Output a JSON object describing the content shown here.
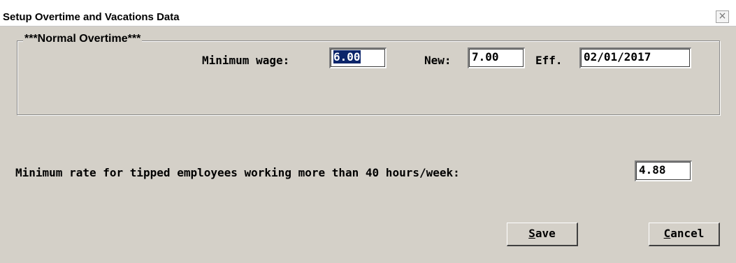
{
  "window": {
    "title": "Setup Overtime and Vacations Data",
    "close_glyph": "×"
  },
  "normal_overtime": {
    "legend": "***Normal Overtime***",
    "minimum_wage_label": "Minimum wage:",
    "minimum_wage_value": "6.00",
    "new_label": "New:",
    "new_value": "7.00",
    "eff_label": "Eff.",
    "eff_value": "02/01/2017"
  },
  "tipped": {
    "label": "Minimum rate for tipped employees working more than 40 hours/week:",
    "value": "4.88"
  },
  "buttons": {
    "save_accel": "S",
    "save_rest": "ave",
    "cancel_accel": "C",
    "cancel_rest": "ancel"
  },
  "colors": {
    "background": "#d4d0c8",
    "selection": "#0a246a"
  }
}
